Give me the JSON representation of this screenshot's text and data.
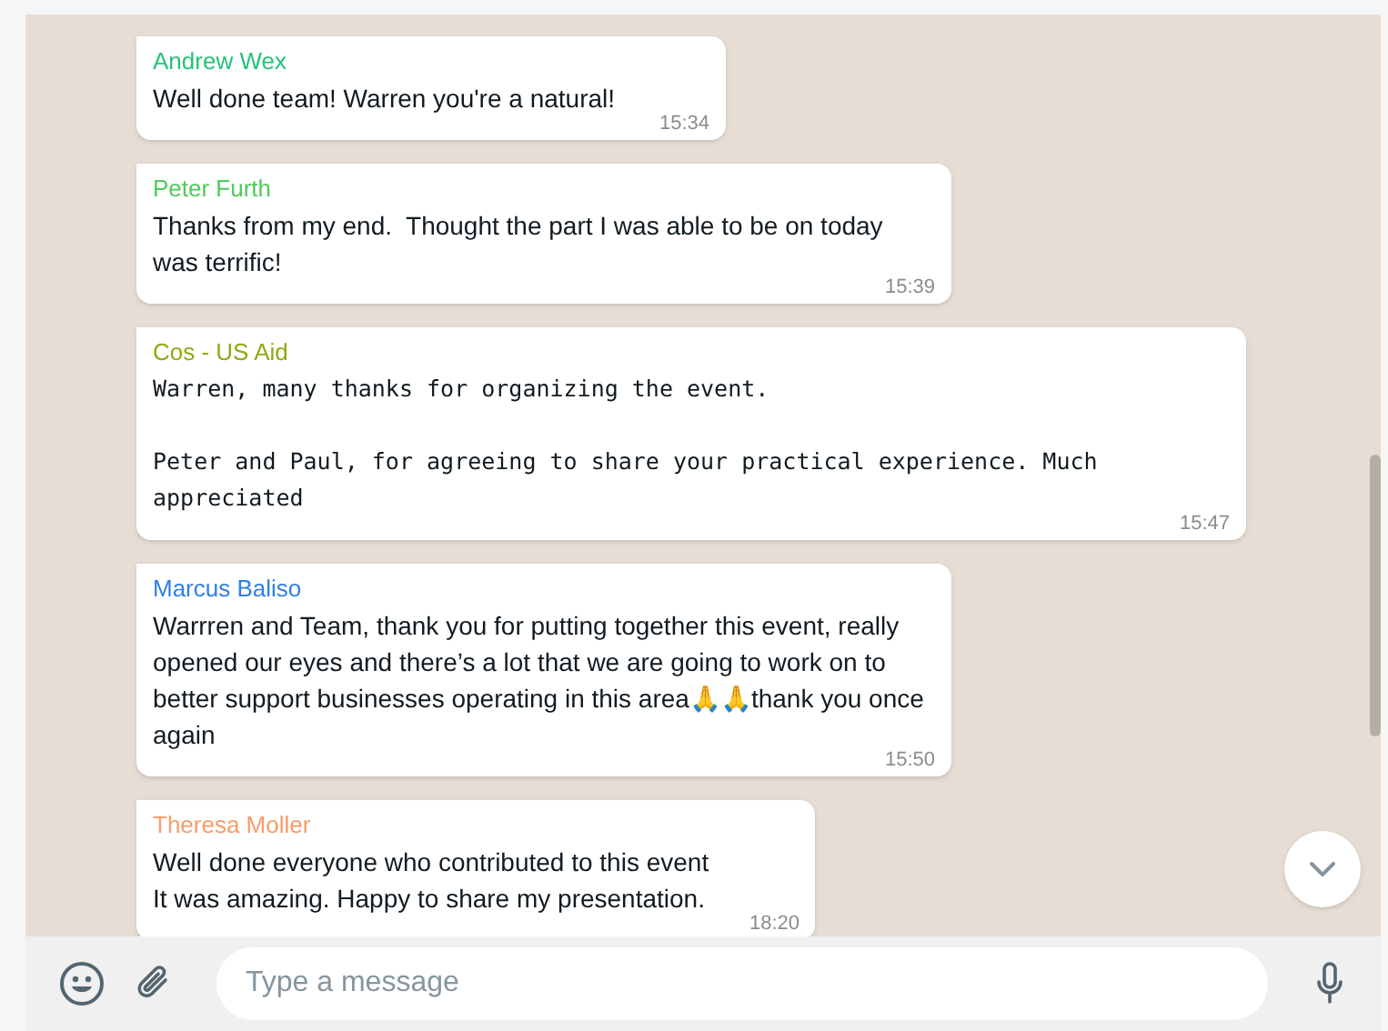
{
  "messages": [
    {
      "sender": "Andrew Wex",
      "color": "#25c27a",
      "kind": "text",
      "text": "Well done team! Warren you're a natural!",
      "time": "15:34"
    },
    {
      "sender": "Peter Furth",
      "color": "#4fc95c",
      "kind": "text",
      "text": "Thanks from my end.  Thought the part I was able to be on today was terrific!",
      "time": "15:39"
    },
    {
      "sender": "Cos - US Aid",
      "color": "#8faa10",
      "kind": "mono",
      "text": "Warren, many thanks for organizing the event.\n\nPeter and Paul, for agreeing to share your practical experience. Much appreciated",
      "time": "15:47"
    },
    {
      "sender": "Marcus Baliso",
      "color": "#2e7fe6",
      "kind": "text",
      "text": "Warrren and Team, thank you for putting together this event, really opened our eyes and there’s a lot that we are going to work on to better support businesses operating in this area🙏🙏thank you once again",
      "time": "15:50"
    },
    {
      "sender": "Theresa Moller",
      "color": "#f79b6a",
      "kind": "text",
      "text": "Well done everyone who contributed to this event\nIt was amazing. Happy to share my presentation.",
      "time": "18:20"
    }
  ],
  "composer": {
    "placeholder": "Type a message"
  }
}
